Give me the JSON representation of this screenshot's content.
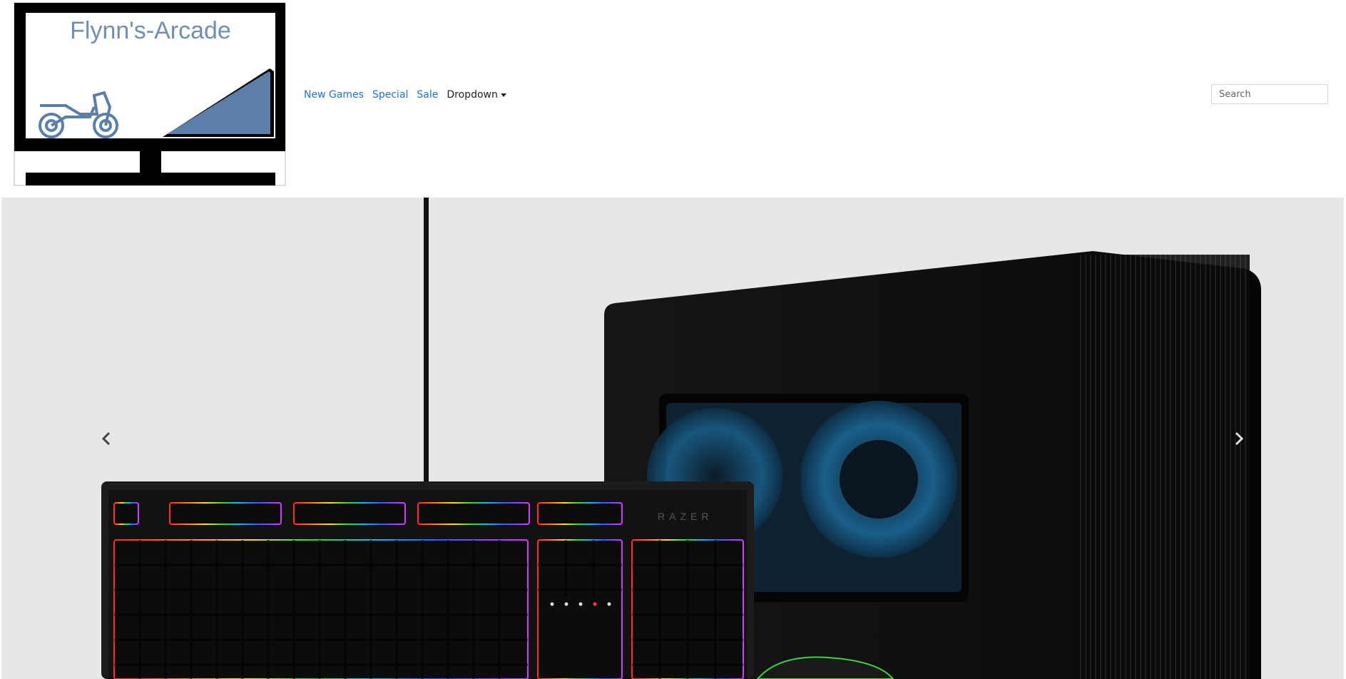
{
  "brand": {
    "logo_text": "Flynn's-Arcade"
  },
  "nav": {
    "items": [
      {
        "label": "New Games"
      },
      {
        "label": "Special"
      },
      {
        "label": "Sale"
      }
    ],
    "dropdown_label": "Dropdown"
  },
  "search": {
    "placeholder": "Search",
    "value": ""
  },
  "carousel": {
    "prev_icon": "chevron-left-icon",
    "next_icon": "chevron-right-icon"
  },
  "colors": {
    "link": "#1a73e8",
    "logo_accent": "#5b7fa8",
    "carousel_bg": "#e7e7e7"
  }
}
